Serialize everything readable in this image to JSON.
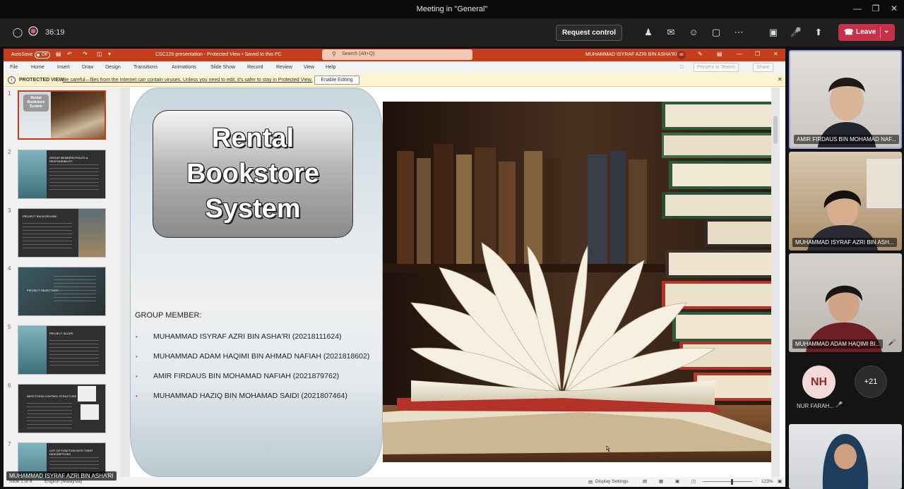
{
  "window": {
    "title": "Meeting in \"General\""
  },
  "meeting": {
    "timer": "36:19",
    "request_control": "Request control",
    "leave": "Leave"
  },
  "ppt": {
    "autosave": "AutoSave",
    "autosave_state": "Off",
    "doc_title": "CSC126 presentation  -  Protected View • Saved to this PC",
    "search_placeholder": "Search (Alt+Q)",
    "user": "MUHAMMAD ISYRAF AZRI BIN ASHA'RI",
    "user_initials": "MI",
    "menu": [
      "File",
      "Home",
      "Insert",
      "Draw",
      "Design",
      "Transitions",
      "Animations",
      "Slide Show",
      "Record",
      "Review",
      "View",
      "Help"
    ],
    "present_in_teams": "Present in Teams",
    "share": "Share",
    "protected_label": "PROTECTED VIEW",
    "protected_msg": "Be careful—files from the Internet can contain viruses. Unless you need to edit, it's safer to stay in Protected View.",
    "enable_editing": "Enable Editing",
    "thumbnails": [
      {
        "num": "1",
        "title": "Rental Bookstore System"
      },
      {
        "num": "2",
        "title": "GROUP MEMBERS ROLES & RESPONSIBILITY"
      },
      {
        "num": "3",
        "title": "PROJECT BACKGROUND"
      },
      {
        "num": "4",
        "title": "PROJECT OBJECTIVES"
      },
      {
        "num": "5",
        "title": "PROJECT SCOPE"
      },
      {
        "num": "6",
        "title": "REPETITION CONTROL STRUCTURE"
      },
      {
        "num": "7",
        "title": "LIST OF FUNCTION WITH THEIR DESCRIPTIONS"
      }
    ],
    "slide": {
      "title_line1": "Rental",
      "title_line2": "Bookstore",
      "title_line3": "System",
      "group_label": "GROUP MEMBER:",
      "members": [
        "MUHAMMAD ISYRAF AZRI BIN ASHA'RI (20218111624)",
        "MUHAMMAD ADAM HAQIMI BIN AHMAD NAFIAH (2021818602)",
        "AMIR FIRDAUS BIN MOHAMAD NAFIAH (2021879762)",
        "MUHAMMAD HAZIQ BIN MOHAMAD SAIDI (2021807464)"
      ]
    },
    "status": {
      "slide_info": "Slide 1 of 8",
      "language": "English (Malaysia)",
      "display_settings": "Display Settings",
      "zoom": "123%"
    }
  },
  "participants": [
    {
      "name": "AMIR FIRDAUS BIN MOHAMAD NAF...",
      "bg": "#d9d6d2"
    },
    {
      "name": "MUHAMMAD ISYRAF AZRI BIN ASH...",
      "bg": "#cbb79b"
    },
    {
      "name": "MUHAMMAD ADAM HAQIMI BI...",
      "bg": "#c8c4be"
    }
  ],
  "others": {
    "initials": "NH",
    "name": "NUR FARAH...",
    "more": "+21"
  },
  "presenter_label": "MUHAMMAD ISYRAF AZRI BIN ASHA'RI",
  "colors": {
    "ppt_accent": "#c43e1c",
    "leave": "#c4314b",
    "protected_bg": "#fff4ce"
  }
}
